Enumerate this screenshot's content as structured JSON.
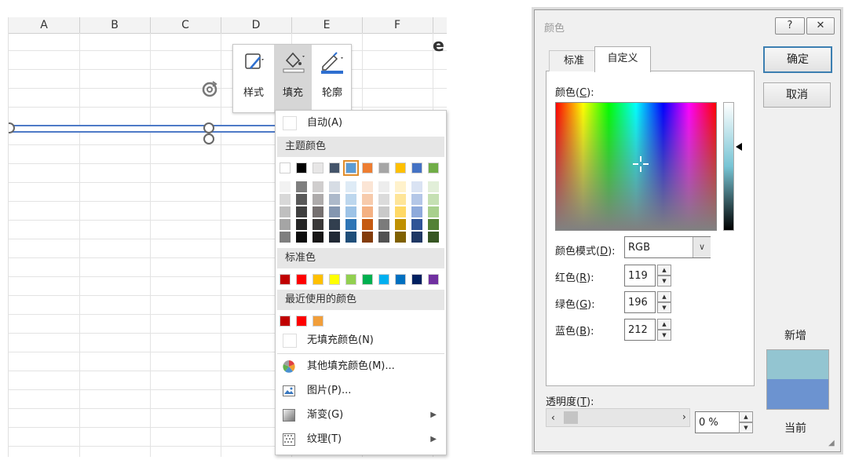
{
  "sheet": {
    "columns": [
      "A",
      "B",
      "C",
      "D",
      "E",
      "F"
    ],
    "edge_letter": "e"
  },
  "mini_toolbar": {
    "style_label": "样式",
    "fill_label": "填充",
    "outline_label": "轮廓"
  },
  "fill_menu": {
    "auto": "自动(A)",
    "theme_colors_header": "主题颜色",
    "theme_colors": [
      "#ffffff",
      "#000000",
      "#e7e6e6",
      "#44546a",
      "#5b9bd5",
      "#ed7d31",
      "#a5a5a5",
      "#ffc000",
      "#4472c4",
      "#70ad47"
    ],
    "theme_shades": [
      [
        "#f2f2f2",
        "#d8d8d8",
        "#bfbfbf",
        "#a5a5a5",
        "#7f7f7f"
      ],
      [
        "#7f7f7f",
        "#595959",
        "#3f3f3f",
        "#262626",
        "#0c0c0c"
      ],
      [
        "#d0cece",
        "#aeabab",
        "#757070",
        "#3a3838",
        "#171616"
      ],
      [
        "#d6dce4",
        "#adb9ca",
        "#8496b0",
        "#323f4f",
        "#222a35"
      ],
      [
        "#deebf6",
        "#bdd7ee",
        "#9dc3e6",
        "#2e75b5",
        "#1f4e79"
      ],
      [
        "#fbe5d5",
        "#f7cbac",
        "#f4b183",
        "#c55a11",
        "#833c0b"
      ],
      [
        "#ededed",
        "#dbdbdb",
        "#c9c9c9",
        "#7b7b7b",
        "#525252"
      ],
      [
        "#fff2cc",
        "#fee599",
        "#ffd965",
        "#bf9000",
        "#7f6000"
      ],
      [
        "#dae3f3",
        "#b4c7e7",
        "#8eaadb",
        "#2f5496",
        "#1f3864"
      ],
      [
        "#e2efd9",
        "#c5e0b3",
        "#a8d08d",
        "#538135",
        "#375623"
      ]
    ],
    "standard_colors_header": "标准色",
    "standard_colors": [
      "#c00000",
      "#ff0000",
      "#ffc000",
      "#ffff00",
      "#92d050",
      "#00b050",
      "#00b0f0",
      "#0070c0",
      "#002060",
      "#7030a0"
    ],
    "recent_colors_header": "最近使用的颜色",
    "recent_colors": [
      "#c00000",
      "#ff0000",
      "#f19e3a"
    ],
    "no_fill": "无填充颜色(N)",
    "more_colors": "其他填充颜色(M)...",
    "picture": "图片(P)...",
    "gradient": "渐变(G)",
    "texture": "纹理(T)"
  },
  "dialog": {
    "title": "颜色",
    "help_glyph": "?",
    "close_glyph": "✕",
    "tab_standard": "标准",
    "tab_custom": "自定义",
    "colors_label_pre": "颜色(",
    "colors_label_key": "C",
    "colors_label_post": "):",
    "mode_label_pre": "颜色模式(",
    "mode_label_key": "D",
    "mode_label_post": "):",
    "mode_value": "RGB",
    "red_label_pre": "红色(",
    "red_label_key": "R",
    "red_label_post": "):",
    "red_value": "119",
    "green_label_pre": "绿色(",
    "green_label_key": "G",
    "green_label_post": "):",
    "green_value": "196",
    "blue_label_pre": "蓝色(",
    "blue_label_key": "B",
    "blue_label_post": "):",
    "blue_value": "212",
    "ok": "确定",
    "cancel": "取消",
    "new_label": "新增",
    "current_label": "当前",
    "new_color": "#93c5d1",
    "current_color": "#6c93d0",
    "transparency_label_pre": "透明度(",
    "transparency_label_key": "T",
    "transparency_label_post": "):",
    "transparency_value": "0 %",
    "scroll_left": "‹",
    "scroll_right": "›"
  }
}
